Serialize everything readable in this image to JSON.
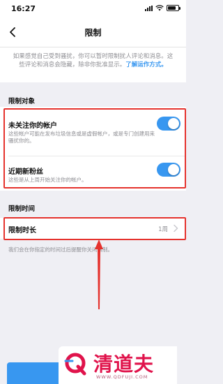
{
  "status_bar": {
    "time": "16:27"
  },
  "nav": {
    "title": "限制"
  },
  "intro": {
    "text": "如果感觉自己受到骚扰，你可以暂时限制扰人评论和消息。这些评论和消息会隐藏，除非你批准显示。",
    "link": "了解运作方式。"
  },
  "section_restrict_who": {
    "title": "限制对象",
    "rows": [
      {
        "title": "未关注你的帐户",
        "desc": "这些帐户可能在发布垃圾信息或是虚假帐户，或是专门创建用来骚扰你的。",
        "toggle_on": true
      },
      {
        "title": "近期新粉丝",
        "desc": "这些是从上周开始关注你的帐户。",
        "toggle_on": true
      }
    ]
  },
  "section_restrict_time": {
    "title": "限制时间",
    "duration_label": "限制时长",
    "duration_value": "1周"
  },
  "footnote": "我们会在你指定的时间过后提醒你关闭限制。",
  "watermark": {
    "brand": "清道夫",
    "url": "WWW.QDFUJI.COM"
  },
  "colors": {
    "accent": "#3897f0",
    "highlight": "#e5322d",
    "brand": "#e0134b"
  }
}
